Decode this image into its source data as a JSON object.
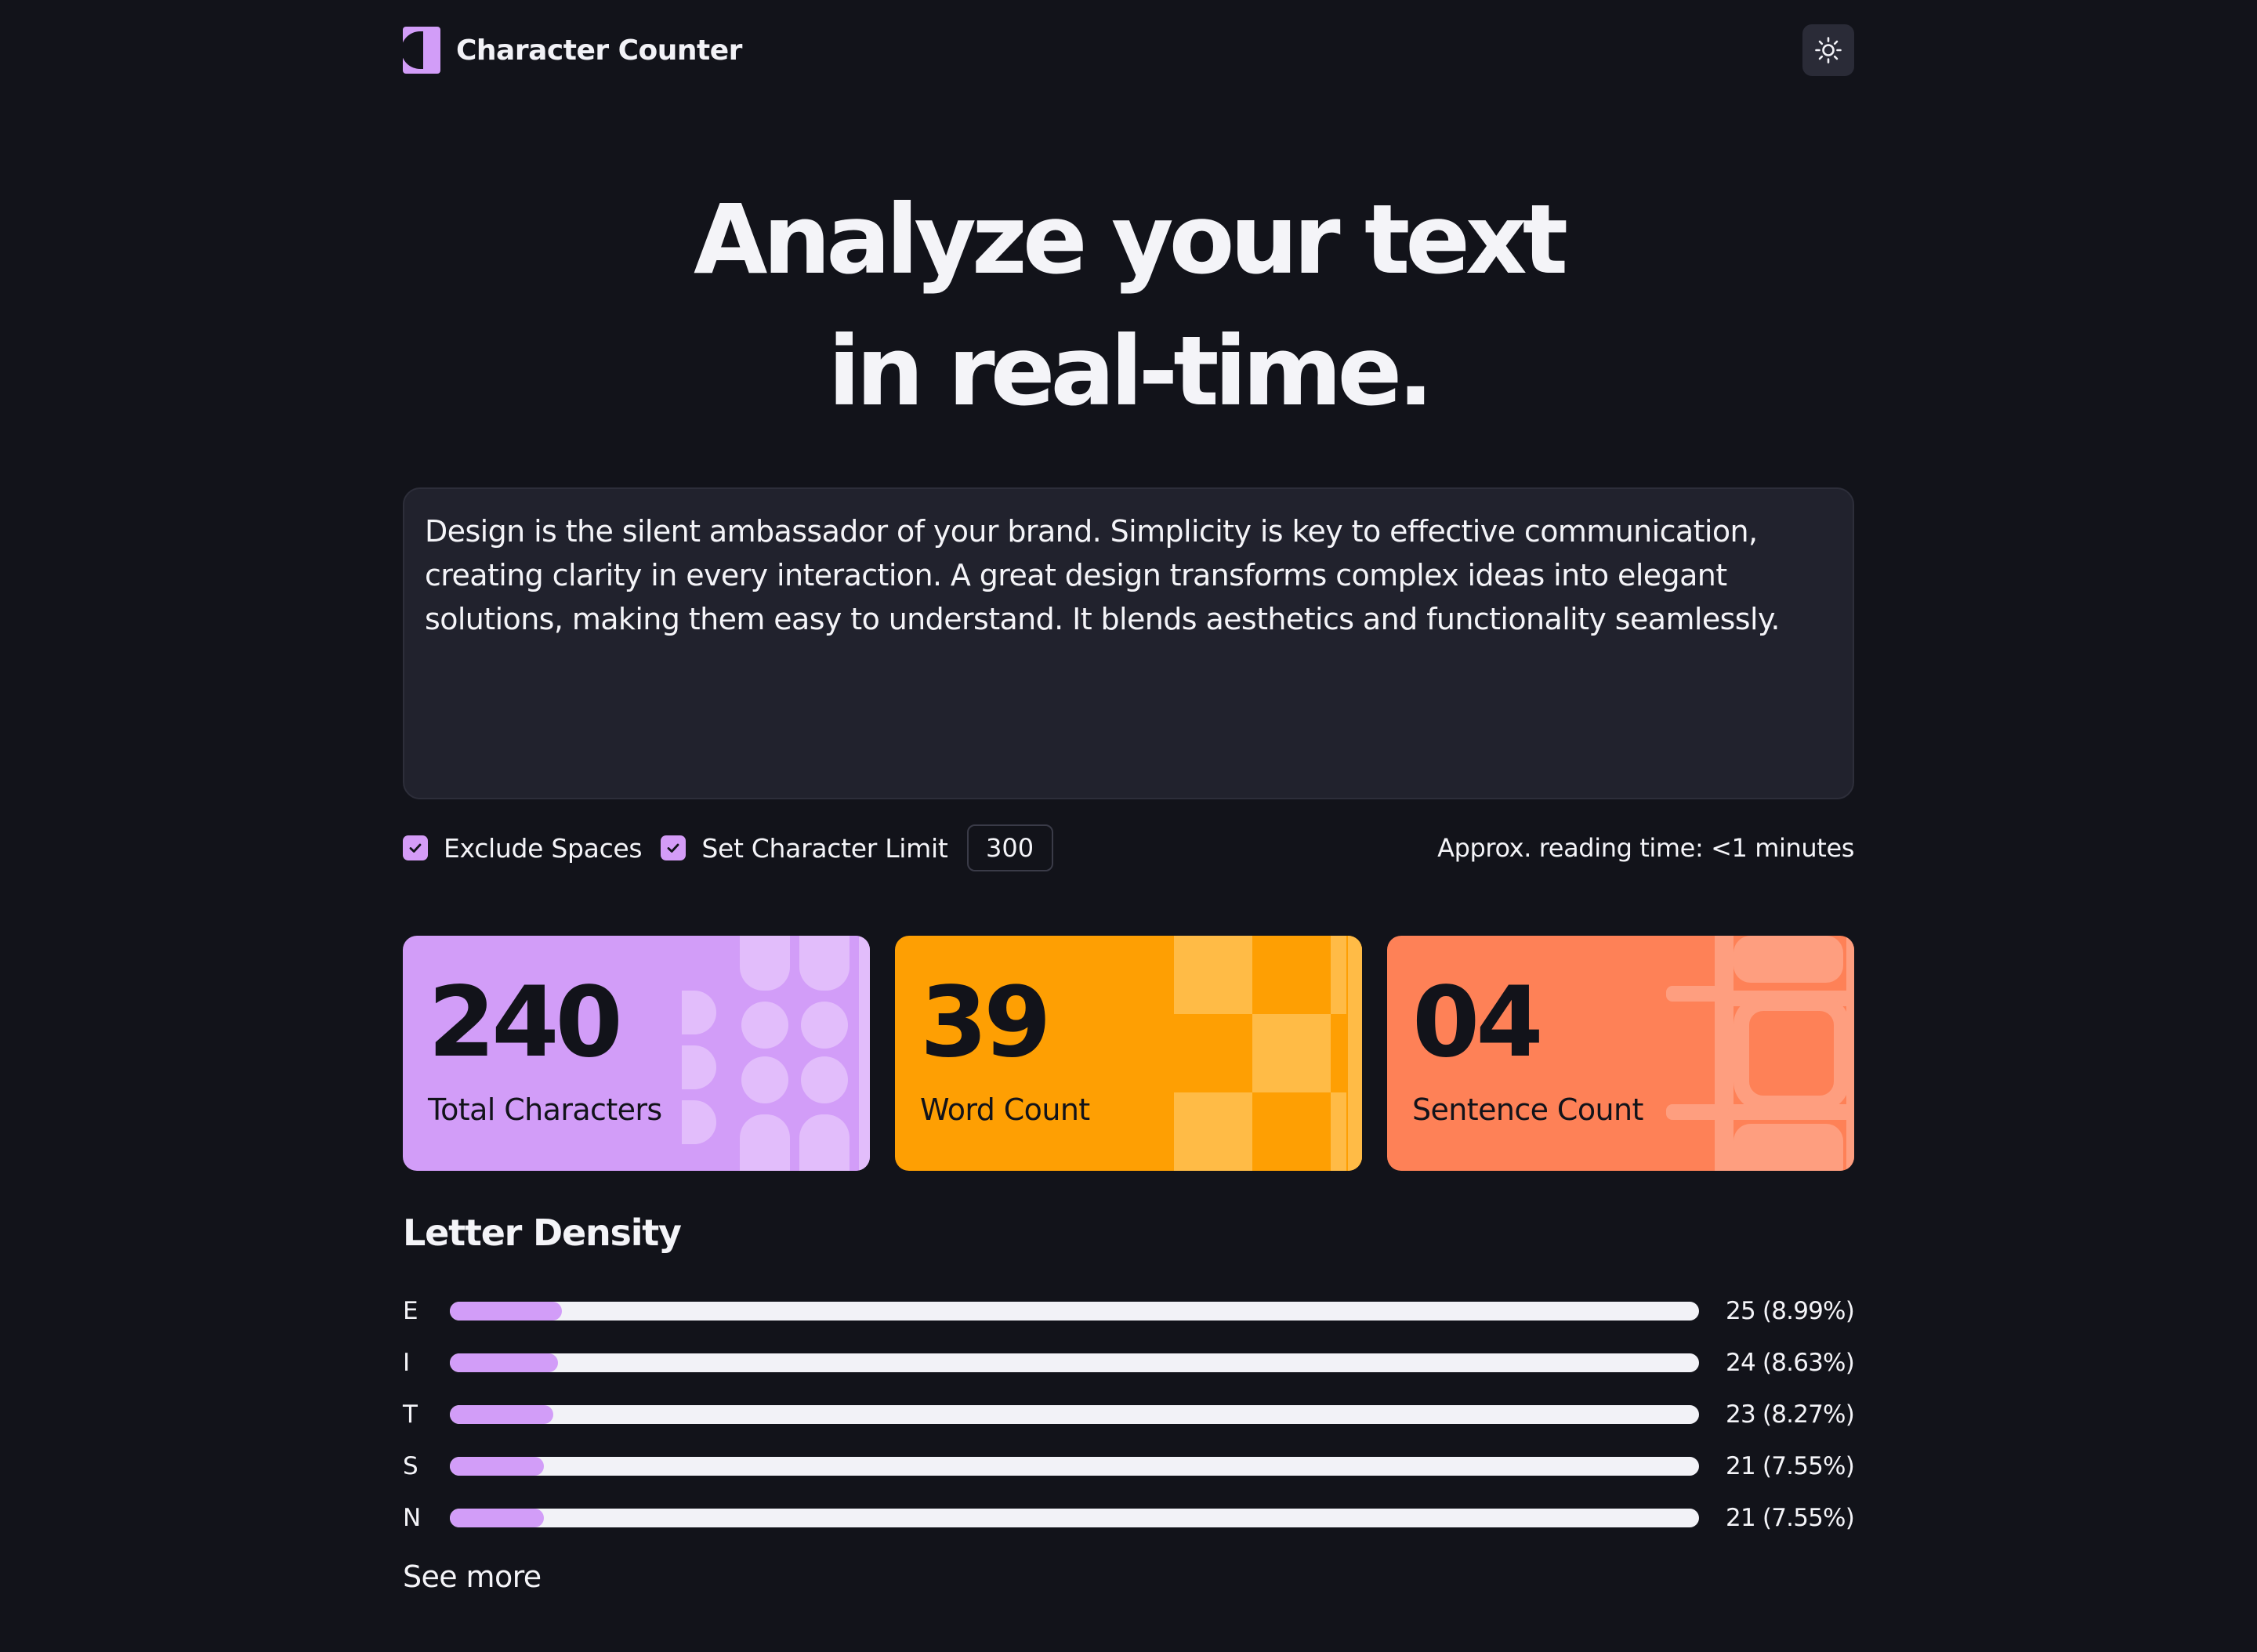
{
  "app": {
    "name": "Character Counter",
    "theme_toggle_icon": "sun-icon",
    "logo_icon": "character-counter-logo-icon"
  },
  "hero": {
    "line1": "Analyze your text",
    "line2": "in real-time."
  },
  "editor": {
    "text": "Design is the silent ambassador of your brand. Simplicity is key to effective communication, creating clarity in every interaction. A great design transforms complex ideas into elegant solutions, making them easy to understand. It blends aesthetics and functionality seamlessly."
  },
  "options": {
    "exclude_spaces_label": "Exclude Spaces",
    "exclude_spaces_checked": true,
    "char_limit_label": "Set Character Limit",
    "char_limit_checked": true,
    "char_limit_value": "300",
    "reading_time": "Approx. reading time: <1 minutes"
  },
  "stats": [
    {
      "value": "240",
      "label": "Total Characters",
      "color": "#d29df8"
    },
    {
      "value": "39",
      "label": "Word Count",
      "color": "#fe9f03"
    },
    {
      "value": "04",
      "label": "Sentence Count",
      "color": "#fe8157"
    }
  ],
  "density": {
    "title": "Letter Density",
    "rows": [
      {
        "letter": "E",
        "value": "25 (8.99%)",
        "percent": 8.99
      },
      {
        "letter": "I",
        "value": "24 (8.63%)",
        "percent": 8.63
      },
      {
        "letter": "T",
        "value": "23 (8.27%)",
        "percent": 8.27
      },
      {
        "letter": "S",
        "value": "21 (7.55%)",
        "percent": 7.55
      },
      {
        "letter": "N",
        "value": "21 (7.55%)",
        "percent": 7.55
      }
    ],
    "see_more": "See more"
  },
  "colors": {
    "background": "#12131a",
    "purple": "#d29df8",
    "orange": "#fe9f03",
    "coral": "#fe8157"
  }
}
